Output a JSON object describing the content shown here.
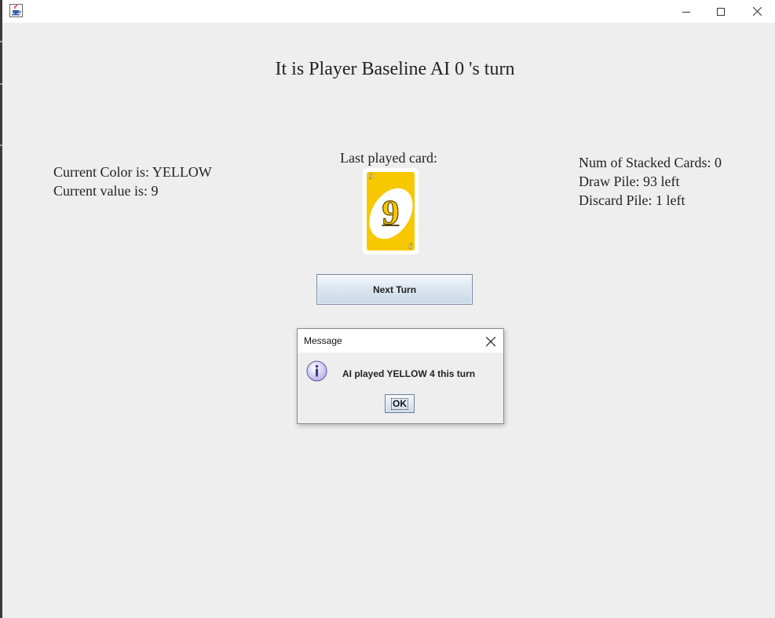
{
  "window": {
    "icon": "java-cup-icon",
    "controls": [
      "minimize-icon",
      "maximize-icon",
      "close-icon"
    ]
  },
  "game": {
    "turn_title": "It is Player Baseline AI 0 's turn",
    "current_color": "Current Color is: YELLOW",
    "current_value": "Current value is: 9",
    "last_played_label": "Last played card:",
    "last_card": {
      "color": "#f7c700",
      "value": "9"
    },
    "stacked_cards": "Num of Stacked Cards: 0",
    "draw_pile": "Draw Pile: 93 left",
    "discard_pile": "Discard Pile: 1 left",
    "next_turn_label": "Next Turn"
  },
  "dialog": {
    "title": "Message",
    "icon": "info-icon",
    "message": "AI played YELLOW 4 this turn",
    "ok_label": "OK"
  }
}
